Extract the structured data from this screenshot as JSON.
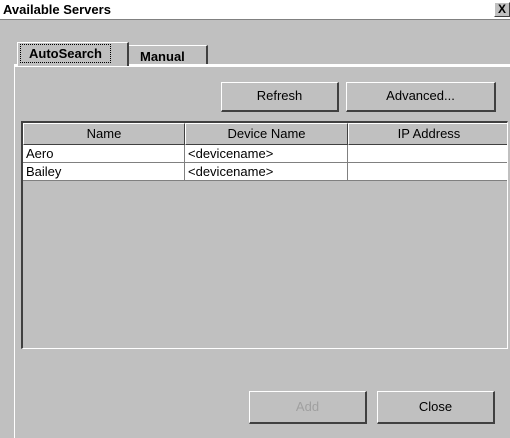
{
  "window": {
    "title": "Available Servers",
    "close_glyph": "X"
  },
  "tabs": [
    {
      "label": "AutoSearch",
      "active": true
    },
    {
      "label": "Manual",
      "active": false
    }
  ],
  "toolbar": {
    "refresh_label": "Refresh",
    "advanced_label": "Advanced..."
  },
  "table": {
    "columns": [
      "Name",
      "Device Name",
      "IP Address"
    ],
    "rows": [
      {
        "name": "Aero",
        "device": "<devicename>",
        "ip": ""
      },
      {
        "name": "Bailey",
        "device": "<devicename>",
        "ip": ""
      }
    ]
  },
  "footer": {
    "add_label": "Add",
    "add_enabled": false,
    "close_label": "Close"
  },
  "icons": {
    "close": "close-icon"
  }
}
